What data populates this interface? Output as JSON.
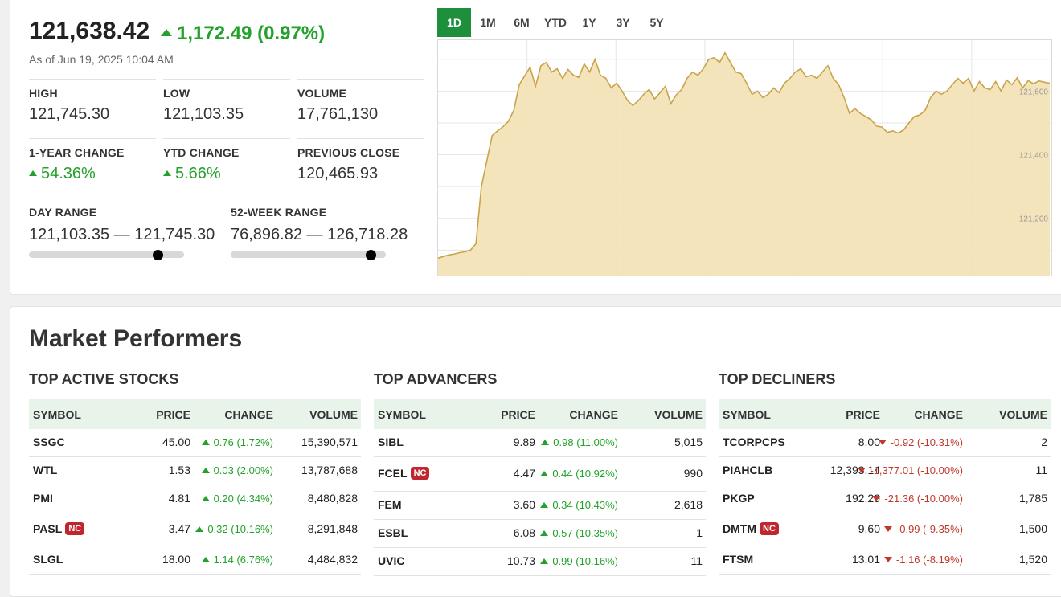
{
  "index": {
    "value": "121,638.42",
    "change": "1,172.49 (0.97%)",
    "as_of": "As of Jun 19, 2025 10:04 AM"
  },
  "stats": {
    "high": {
      "label": "HIGH",
      "value": "121,745.30"
    },
    "low": {
      "label": "LOW",
      "value": "121,103.35"
    },
    "volume": {
      "label": "VOLUME",
      "value": "17,761,130"
    },
    "one_year_change": {
      "label": "1-YEAR CHANGE",
      "value": "54.36%"
    },
    "ytd_change": {
      "label": "YTD CHANGE",
      "value": "5.66%"
    },
    "previous_close": {
      "label": "PREVIOUS CLOSE",
      "value": "120,465.93"
    },
    "day_range": {
      "label": "DAY RANGE",
      "value": "121,103.35 — 121,745.30",
      "position": 0.83
    },
    "week52_range": {
      "label": "52-WEEK RANGE",
      "value": "76,896.82 — 126,718.28",
      "position": 0.9
    }
  },
  "chart_tabs": [
    "1D",
    "1M",
    "6M",
    "YTD",
    "1Y",
    "3Y",
    "5Y"
  ],
  "active_tab": "1D",
  "chart_data": {
    "type": "area",
    "ylim": [
      121020,
      121760
    ],
    "y_ticks": [
      "121,200",
      "121,400",
      "121,600"
    ],
    "y_tick_values": [
      121200,
      121400,
      121600
    ],
    "values": [
      121075,
      121080,
      121085,
      121088,
      121092,
      121095,
      121100,
      121120,
      121300,
      121380,
      121460,
      121475,
      121488,
      121505,
      121540,
      121620,
      121648,
      121675,
      121615,
      121680,
      121690,
      121660,
      121670,
      121640,
      121668,
      121650,
      121643,
      121685,
      121660,
      121700,
      121650,
      121640,
      121610,
      121625,
      121600,
      121570,
      121555,
      121570,
      121590,
      121605,
      121575,
      121595,
      121615,
      121560,
      121588,
      121605,
      121640,
      121660,
      121650,
      121670,
      121700,
      121705,
      121690,
      121720,
      121690,
      121660,
      121655,
      121625,
      121590,
      121600,
      121580,
      121590,
      121610,
      121595,
      121625,
      121640,
      121660,
      121670,
      121645,
      121650,
      121640,
      121660,
      121680,
      121640,
      121620,
      121580,
      121530,
      121545,
      121530,
      121520,
      121510,
      121490,
      121487,
      121470,
      121475,
      121468,
      121478,
      121500,
      121520,
      121525,
      121540,
      121580,
      121600,
      121590,
      121600,
      121620,
      121640,
      121625,
      121640,
      121600,
      121630,
      121610,
      121605,
      121630,
      121600,
      121635,
      121620,
      121642,
      121610,
      121633,
      121623,
      121632,
      121628,
      121625
    ],
    "grid": true
  },
  "performers": {
    "title": "Market Performers",
    "columns": [
      "SYMBOL",
      "PRICE",
      "CHANGE",
      "VOLUME"
    ],
    "nc_label": "NC",
    "active": {
      "title": "TOP ACTIVE STOCKS",
      "rows": [
        {
          "symbol": "SSGC",
          "nc": false,
          "price": "45.00",
          "change": "0.76 (1.72%)",
          "volume": "15,390,571"
        },
        {
          "symbol": "WTL",
          "nc": false,
          "price": "1.53",
          "change": "0.03 (2.00%)",
          "volume": "13,787,688"
        },
        {
          "symbol": "PMI",
          "nc": false,
          "price": "4.81",
          "change": "0.20 (4.34%)",
          "volume": "8,480,828"
        },
        {
          "symbol": "PASL",
          "nc": true,
          "price": "3.47",
          "change": "0.32 (10.16%)",
          "volume": "8,291,848"
        },
        {
          "symbol": "SLGL",
          "nc": false,
          "price": "18.00",
          "change": "1.14 (6.76%)",
          "volume": "4,484,832"
        }
      ]
    },
    "advancers": {
      "title": "TOP ADVANCERS",
      "rows": [
        {
          "symbol": "SIBL",
          "nc": false,
          "price": "9.89",
          "change": "0.98 (11.00%)",
          "volume": "5,015"
        },
        {
          "symbol": "FCEL",
          "nc": true,
          "price": "4.47",
          "change": "0.44 (10.92%)",
          "volume": "990"
        },
        {
          "symbol": "FEM",
          "nc": false,
          "price": "3.60",
          "change": "0.34 (10.43%)",
          "volume": "2,618"
        },
        {
          "symbol": "ESBL",
          "nc": false,
          "price": "6.08",
          "change": "0.57 (10.35%)",
          "volume": "1"
        },
        {
          "symbol": "UVIC",
          "nc": false,
          "price": "10.73",
          "change": "0.99 (10.16%)",
          "volume": "11"
        }
      ]
    },
    "decliners": {
      "title": "TOP DECLINERS",
      "rows": [
        {
          "symbol": "TCORPCPS",
          "nc": false,
          "price": "8.00",
          "change": "-0.92 (-10.31%)",
          "volume": "2"
        },
        {
          "symbol": "PIAHCLB",
          "nc": false,
          "price": "12,393.14",
          "change": "-1,377.01 (-10.00%)",
          "volume": "11"
        },
        {
          "symbol": "PKGP",
          "nc": false,
          "price": "192.29",
          "change": "-21.36 (-10.00%)",
          "volume": "1,785"
        },
        {
          "symbol": "DMTM",
          "nc": true,
          "price": "9.60",
          "change": "-0.99 (-9.35%)",
          "volume": "1,500"
        },
        {
          "symbol": "FTSM",
          "nc": false,
          "price": "13.01",
          "change": "-1.16 (-8.19%)",
          "volume": "1,520"
        }
      ]
    }
  },
  "colors": {
    "up": "#22a22a",
    "down": "#c0392b",
    "accent": "#1e8f3a",
    "area_fill": "#f3e1b5",
    "area_line": "#c9a44a"
  }
}
